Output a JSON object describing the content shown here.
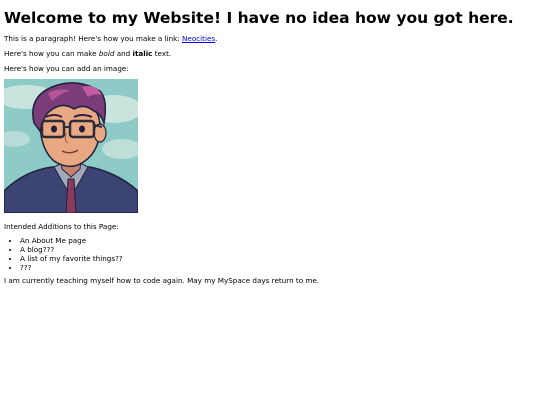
{
  "heading": "Welcome to my Website! I have no idea how you got here.",
  "paragraph_link": {
    "before": "This is a paragraph! Here's how you make a link: ",
    "link_text": "Neocities",
    "after": "."
  },
  "paragraph_format": {
    "part1": "Here's how you can make ",
    "bold_word": "bold",
    "part2": " and ",
    "italic_word": "italic",
    "part3": " text."
  },
  "paragraph_image": "Here's how you can add an image:",
  "avatar": {
    "alt": "Cartoon avatar of a man with purple-pink hair and glasses",
    "colors": {
      "sky": "#8ecac6",
      "cloud": "#c9e4dc",
      "hair": "#7a3d7a",
      "hair_light": "#c45aa0",
      "skin": "#e8a882",
      "skin_shade": "#c7826b",
      "glasses": "#2b2b3a",
      "jacket": "#3c4474",
      "shirt": "#a5a8b8",
      "tie": "#8a3a5a"
    }
  },
  "intended_title": "Intended Additions to this Page:",
  "intended_items": [
    "An About Me page",
    "A blog???",
    "A list of my favorite things??",
    "???"
  ],
  "closing": "I am currently teaching myself how to code again. May my MySpace days return to me."
}
